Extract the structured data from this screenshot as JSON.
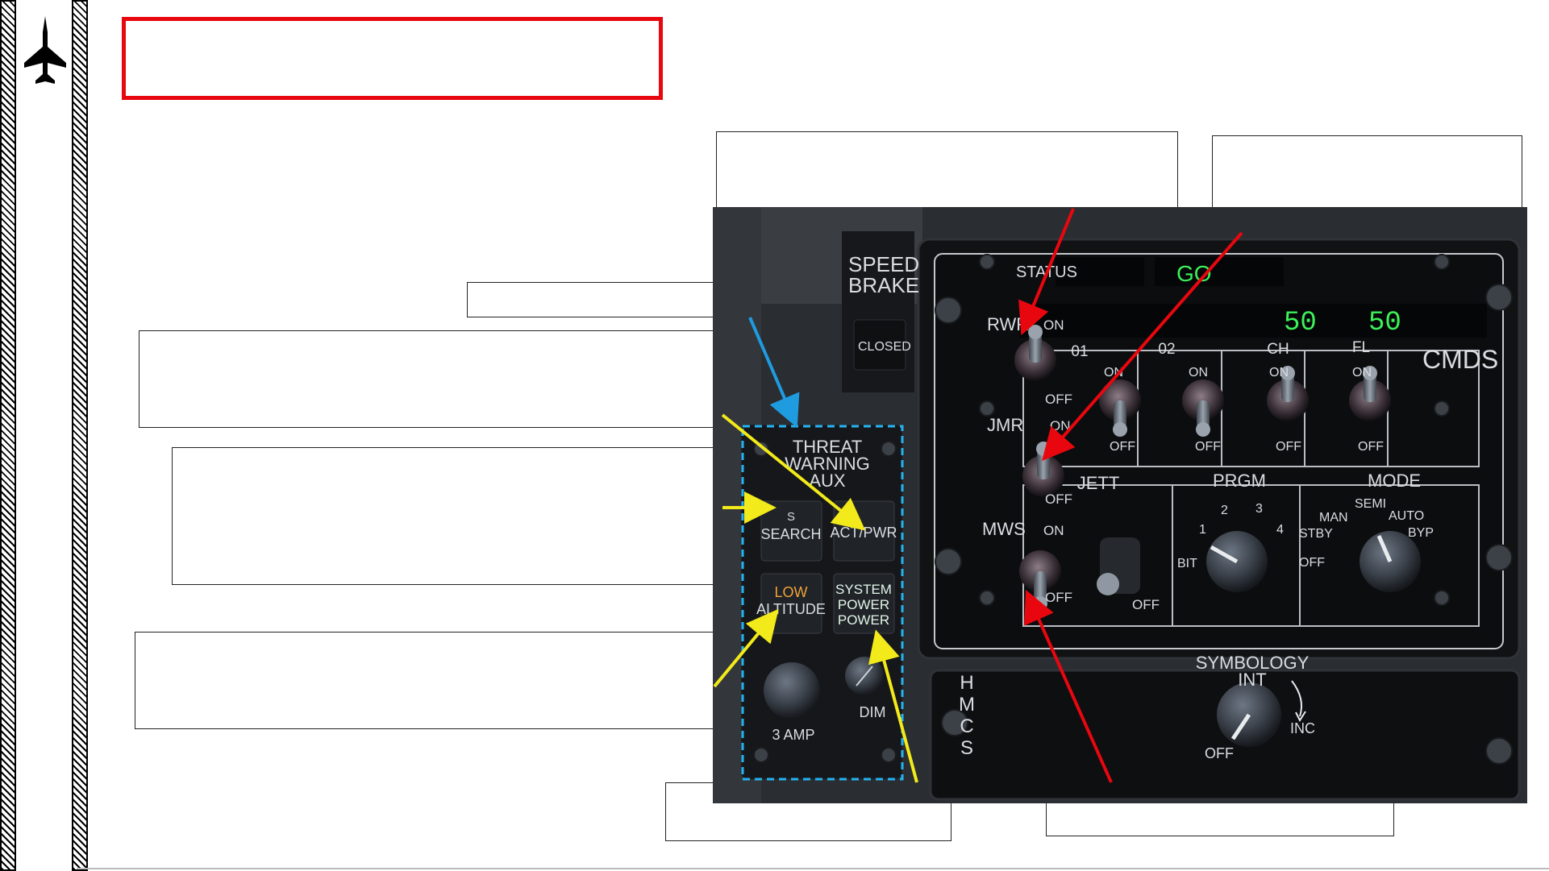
{
  "title": "",
  "callouts": {
    "top_center": "",
    "top_right": "",
    "small_label": "",
    "left_upper": "",
    "left_middle": "",
    "left_lower": "",
    "bottom_center": "",
    "bottom_right": ""
  },
  "panel": {
    "speed_brake": {
      "line1": "SPEED",
      "line2": "BRAKE",
      "state": "CLOSED"
    },
    "threat_warning_aux": {
      "title_line1": "THREAT",
      "title_line2": "WARNING",
      "title_line3": "AUX",
      "search_top": "S",
      "search_label": "SEARCH",
      "act_pwr_label": "ACT/PWR",
      "low_altitude_line1": "LOW",
      "low_altitude_line2": "ALTITUDE",
      "system_power_line1": "SYSTEM",
      "system_power_line2": "POWER",
      "system_power_line3": "POWER",
      "knob_3amp": "3 AMP",
      "knob_dim": "DIM"
    },
    "cmds": {
      "name": "CMDS",
      "status_label": "STATUS",
      "status_value": "GO",
      "counter_ch": "50",
      "counter_fl": "50",
      "rwr_label": "RWR",
      "jmr_label": "JMR",
      "mws_label": "MWS",
      "on": "ON",
      "off": "OFF",
      "switches": [
        "01",
        "02",
        "CH",
        "FL"
      ],
      "jett_label": "JETT",
      "prgm_label": "PRGM",
      "prgm_marks": [
        "BIT",
        "1",
        "2",
        "3",
        "4"
      ],
      "mode_label": "MODE",
      "mode_marks": [
        "OFF",
        "STBY",
        "MAN",
        "SEMI",
        "AUTO",
        "BYP"
      ]
    },
    "hmcs": {
      "name": "HMCS",
      "symbology_line1": "SYMBOLOGY",
      "symbology_line2": "INT",
      "inc": "INC",
      "off": "OFF"
    }
  },
  "colors": {
    "title_border": "#e8070f",
    "arrow_red": "#e8070f",
    "arrow_yellow": "#f2ea1a",
    "arrow_blue": "#1f9be0",
    "dashed_box": "#25b3f0",
    "display_green": "#3cf25a",
    "panel_text": "#d9dde2"
  }
}
